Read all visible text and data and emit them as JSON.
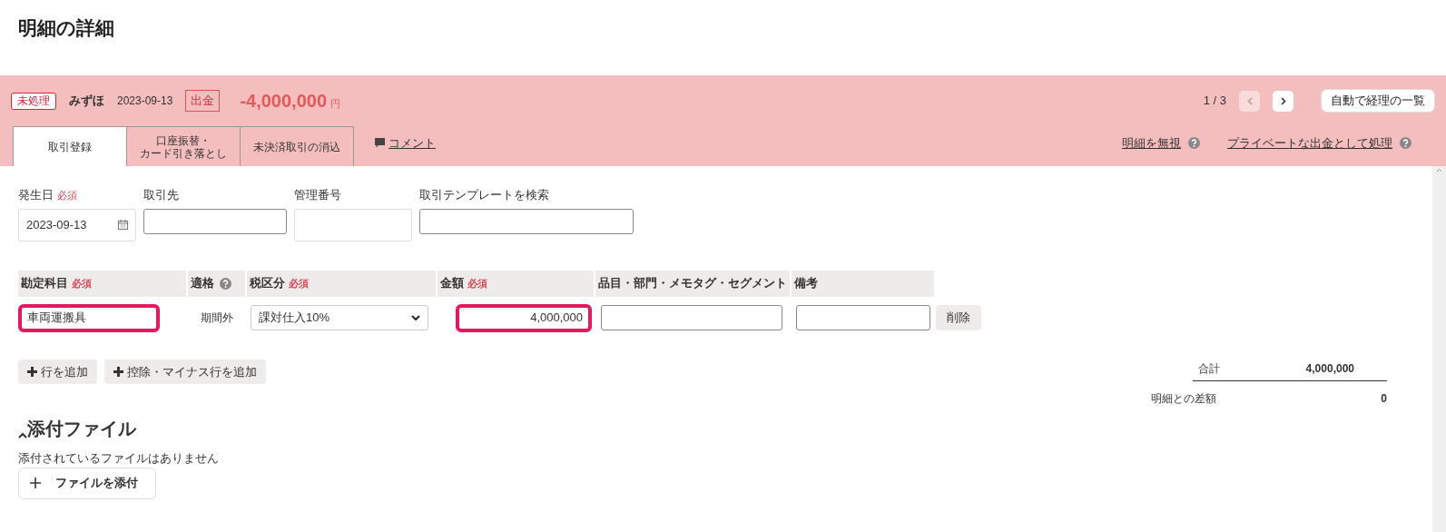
{
  "title": "明細の詳細",
  "header": {
    "status": "未処理",
    "bank": "みずほ",
    "date": "2023-09-13",
    "direction": "出金",
    "amount": "-4,000,000",
    "currency": "円"
  },
  "pager": {
    "text": "1 / 3",
    "prev_disabled": true,
    "next_disabled": false
  },
  "auto_button": "自動で経理の一覧",
  "tabs": [
    {
      "label": "取引登録",
      "selected": true
    },
    {
      "lines": [
        "口座振替・",
        "カード引き落とし"
      ],
      "selected": false
    },
    {
      "label": "未決済取引の消込",
      "selected": false
    }
  ],
  "comment_link": "コメント",
  "links": [
    {
      "label": "明細を無視"
    },
    {
      "label": "プライベートな出金として処理"
    }
  ],
  "fields": [
    {
      "kind": "date",
      "label": "発生日",
      "required": "必須",
      "value": "2023-09-13"
    },
    {
      "kind": "text",
      "label": "取引先"
    },
    {
      "kind": "plain",
      "label": "管理番号"
    },
    {
      "kind": "wide",
      "label": "取引テンプレートを検索"
    }
  ],
  "columns": [
    {
      "label": "勘定科目",
      "required": "必須",
      "help": false
    },
    {
      "label": "適格",
      "help": true
    },
    {
      "label": "税区分",
      "required": "必須",
      "help": false
    },
    {
      "label": "金額",
      "required": "必須",
      "help": false
    },
    {
      "label": "品目・部門・メモタグ・セグメント",
      "help": false
    },
    {
      "label": "備考",
      "help": false
    }
  ],
  "rows": [
    {
      "account": "車両運搬具",
      "account_error": true,
      "eligibility": "期間外",
      "tax": "課対仕入10%",
      "amount": "4,000,000",
      "amount_error": true,
      "delete": "削除"
    }
  ],
  "add_buttons": [
    "行を追加",
    "控除・マイナス行を追加"
  ],
  "totals": [
    {
      "label": "合計",
      "value": "4,000,000"
    },
    {
      "label": "明細との差額",
      "value": "0"
    }
  ],
  "attachments": {
    "heading": "添付ファイル",
    "expanded": true,
    "empty_text": "添付されているファイルはありません",
    "button": "ファイルを添付"
  }
}
